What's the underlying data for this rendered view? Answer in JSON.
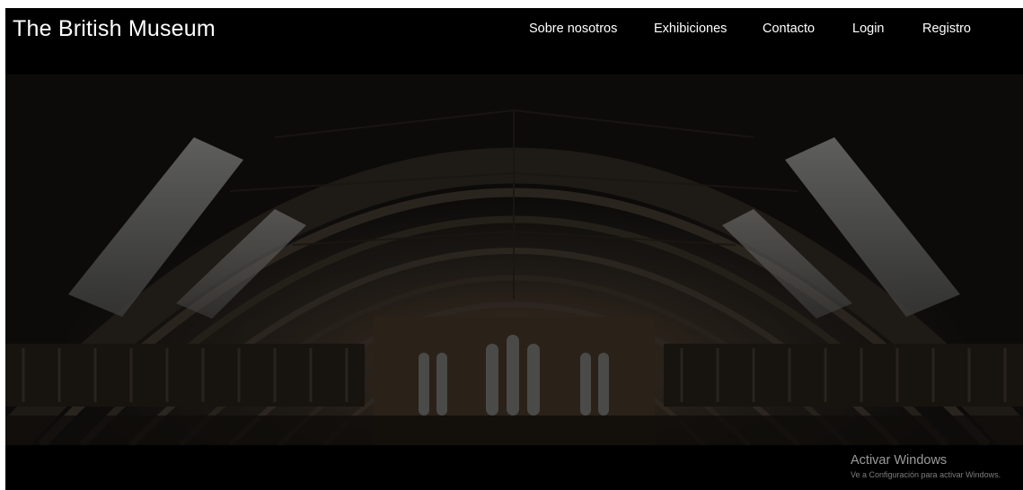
{
  "header": {
    "brand": "The British Museum",
    "nav": [
      {
        "label": "Sobre nosotros"
      },
      {
        "label": "Exhibiciones"
      },
      {
        "label": "Contacto"
      },
      {
        "label": "Login"
      },
      {
        "label": "Registro"
      }
    ]
  },
  "hero": {
    "image_subject": "museum-hall-arched-ironwork-roof"
  },
  "watermark": {
    "title": "Activar Windows",
    "subtitle": "Ve a Configuración para activar Windows."
  },
  "colors": {
    "background": "#000000",
    "text": "#ffffff",
    "hero_shadow": "#0d0c0b",
    "skylight": "#6e6e6e",
    "stone": "#3a2f24"
  }
}
